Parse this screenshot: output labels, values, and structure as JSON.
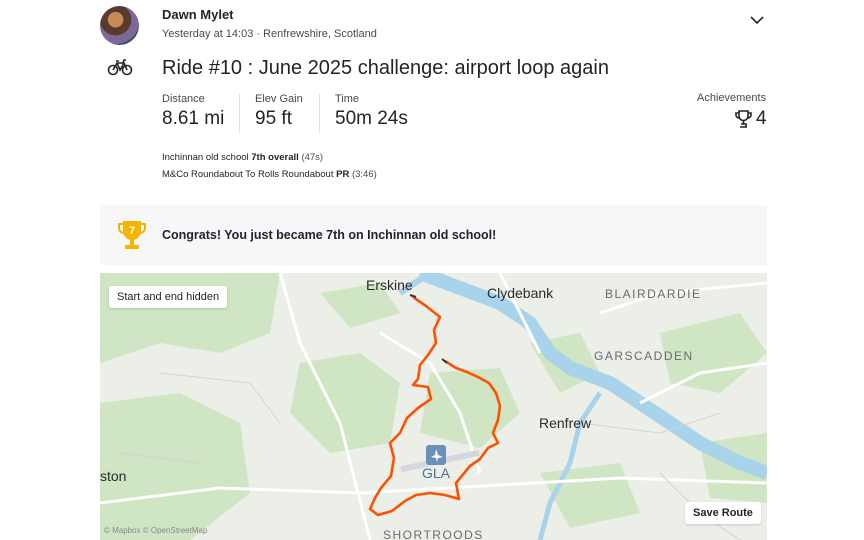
{
  "athlete": {
    "name": "Dawn Mylet",
    "meta": "Yesterday at 14:03 · Renfrewshire, Scotland"
  },
  "activity": {
    "title": "Ride #10 : June 2025 challenge: airport loop again",
    "sport_icon": "bike-icon"
  },
  "stats": [
    {
      "label": "Distance",
      "value": "8.61 mi"
    },
    {
      "label": "Elev Gain",
      "value": "95 ft"
    },
    {
      "label": "Time",
      "value": "50m 24s"
    }
  ],
  "achievements": {
    "label": "Achievements",
    "value": "4"
  },
  "segments": [
    {
      "name": "Inchinnan old school",
      "rank": "7th overall",
      "time": "(47s)"
    },
    {
      "name": "M&Co Roundabout To Rolls Roundabout",
      "rank": "PR",
      "time": "(3:46)"
    }
  ],
  "congrats": {
    "text": "Congrats! You just became 7th on Inchinnan old school!",
    "trophy_number": "7"
  },
  "map": {
    "privacy_label": "Start and end hidden",
    "save_route_label": "Save Route",
    "copyright": "© Mapbox © OpenStreetMap",
    "places": {
      "erskine": "Erskine",
      "clydebank": "Clydebank",
      "blairdardie": "BLAIRDARDIE",
      "garscadden": "GARSCADDEN",
      "renfrew": "Renfrew",
      "gla": "GLA",
      "ston": "ston",
      "shortroods": "SHORTROODS"
    },
    "route_color": "#fc5200",
    "water_color": "#a8d3ea",
    "green_color": "#cfe5c4"
  }
}
